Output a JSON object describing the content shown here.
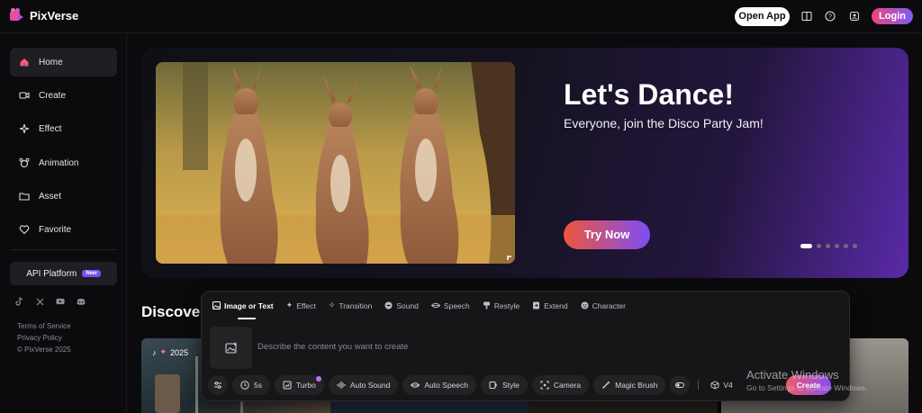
{
  "brand": {
    "name": "PixVerse"
  },
  "header": {
    "open_app": "Open App",
    "login": "Login",
    "icons": [
      "book-icon",
      "help-icon",
      "community-icon"
    ]
  },
  "sidebar": {
    "items": [
      {
        "label": "Home",
        "icon": "home-icon",
        "active": true
      },
      {
        "label": "Create",
        "icon": "video-icon"
      },
      {
        "label": "Effect",
        "icon": "sparkle-icon"
      },
      {
        "label": "Animation",
        "icon": "animation-icon"
      },
      {
        "label": "Asset",
        "icon": "folder-icon"
      },
      {
        "label": "Favorite",
        "icon": "heart-icon"
      }
    ],
    "api_platform": "API Platform",
    "new_badge": "New",
    "socials": [
      "tiktok-icon",
      "x-icon",
      "youtube-icon",
      "discord-icon"
    ],
    "terms": "Terms of Service",
    "privacy": "Privacy Policy",
    "copyright": "© PixVerse 2025"
  },
  "hero": {
    "title": "Let's Dance!",
    "subtitle": "Everyone, join the Disco Party Jam!",
    "cta": "Try Now",
    "slide_count": 6,
    "active_slide": 1
  },
  "discover": {
    "title": "Discover",
    "card_badge": "2025"
  },
  "prompt_panel": {
    "tabs": [
      {
        "label": "Image or Text",
        "icon": "image-icon",
        "active": true
      },
      {
        "label": "Effect",
        "icon": "sparkle-icon"
      },
      {
        "label": "Transition",
        "icon": "transition-icon"
      },
      {
        "label": "Sound",
        "icon": "sound-icon"
      },
      {
        "label": "Speech",
        "icon": "lips-icon"
      },
      {
        "label": "Restyle",
        "icon": "brush-icon"
      },
      {
        "label": "Extend",
        "icon": "extend-icon"
      },
      {
        "label": "Character",
        "icon": "character-icon"
      }
    ],
    "placeholder": "Describe the content you want to create",
    "options": {
      "duration": "5s",
      "turbo": "Turbo",
      "auto_sound": "Auto Sound",
      "auto_speech": "Auto Speech",
      "style": "Style",
      "camera": "Camera",
      "magic_brush": "Magic Brush"
    },
    "model": "V4",
    "create": "Create"
  },
  "overlay": {
    "activate_title": "Activate Windows",
    "activate_sub": "Go to Settings to activate Windows."
  }
}
